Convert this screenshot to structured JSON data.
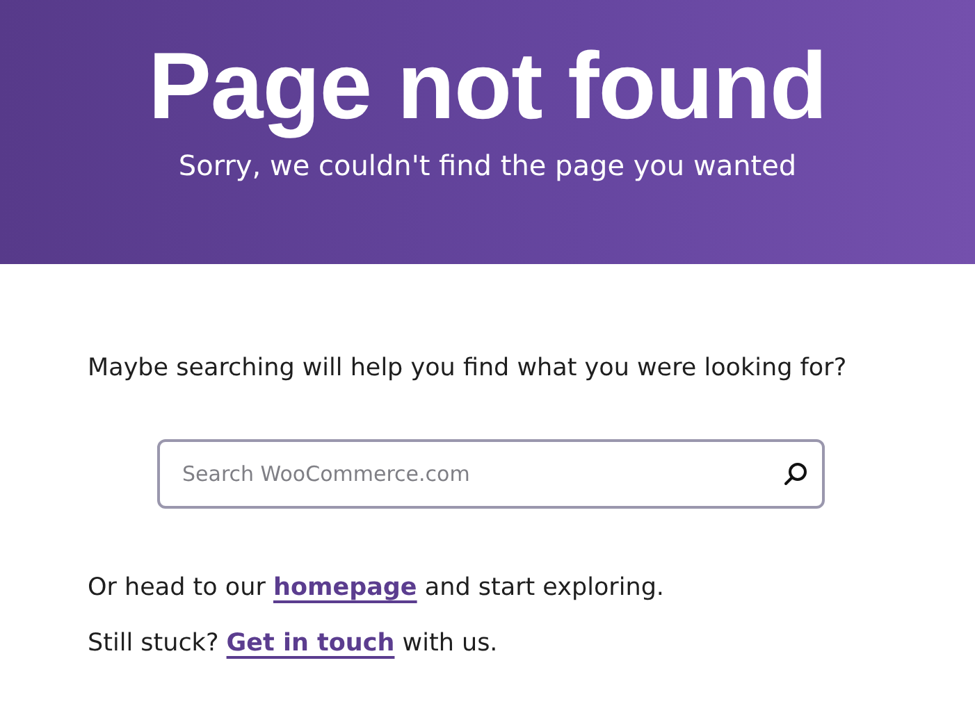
{
  "hero": {
    "title": "Page not found",
    "subtitle": "Sorry, we couldn't find the page you wanted"
  },
  "prompt": "Maybe searching will help you find what you were looking for?",
  "search": {
    "placeholder": "Search WooCommerce.com"
  },
  "links": [
    {
      "before": "Or head to our ",
      "link": "homepage",
      "after": " and start exploring."
    },
    {
      "before": "Still stuck? ",
      "link": "Get in touch",
      "after": " with us."
    }
  ]
}
